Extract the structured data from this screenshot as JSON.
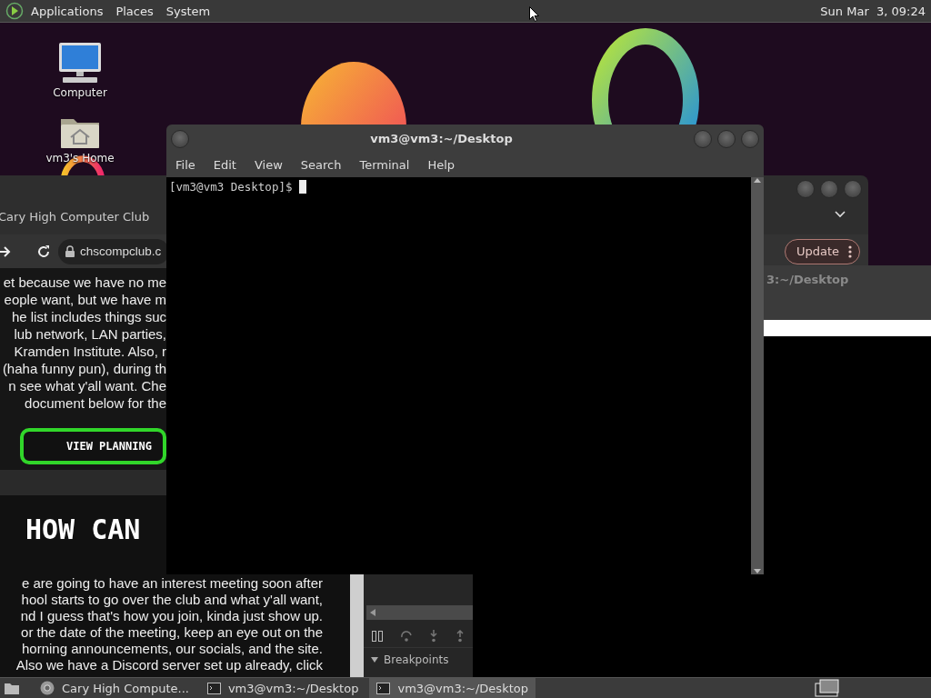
{
  "top_panel": {
    "menus": [
      "Applications",
      "Places",
      "System"
    ],
    "clock": "Sun Mar  3, 09:24"
  },
  "desktop_icons": [
    {
      "kind": "computer",
      "label": "Computer"
    },
    {
      "kind": "home",
      "label": "vm3's Home"
    }
  ],
  "browser": {
    "tab_title": "Cary High Computer Club",
    "url": "chscompclub.c",
    "update_button": "Update",
    "paragraph_1": [
      "et because we have no me",
      "eople want, but we have m",
      "he list includes things suc",
      "lub network, LAN parties,",
      "Kramden Institute. Also, r",
      "(haha funny pun), during th",
      "n see what y'all want. Che",
      "document below for the"
    ],
    "planning_button": "VIEW PLANNING",
    "heading": "HOW CAN",
    "paragraph_2": [
      "e are going to have an interest meeting soon after",
      "hool starts to go over the club and what y'all want,",
      "nd I guess that's how you join, kinda just show up.",
      "or the date of the meeting, keep an eye out on the",
      "horning announcements, our socials, and the site.",
      "Also we have a Discord server set up already, click"
    ],
    "devtools": {
      "section": "Breakpoints",
      "expanded": true
    }
  },
  "terminal_back": {
    "title": "3:~/Desktop"
  },
  "terminal": {
    "title": "vm3@vm3:~/Desktop",
    "menus": [
      "File",
      "Edit",
      "View",
      "Search",
      "Terminal",
      "Help"
    ],
    "prompt": "[vm3@vm3 Desktop]$ "
  },
  "taskbar": {
    "tasks": [
      {
        "kind": "browser",
        "label": "Cary High Compute...",
        "selected": false
      },
      {
        "kind": "terminal",
        "label": "vm3@vm3:~/Desktop",
        "selected": false
      },
      {
        "kind": "terminal",
        "label": "vm3@vm3:~/Desktop",
        "selected": true
      }
    ]
  }
}
